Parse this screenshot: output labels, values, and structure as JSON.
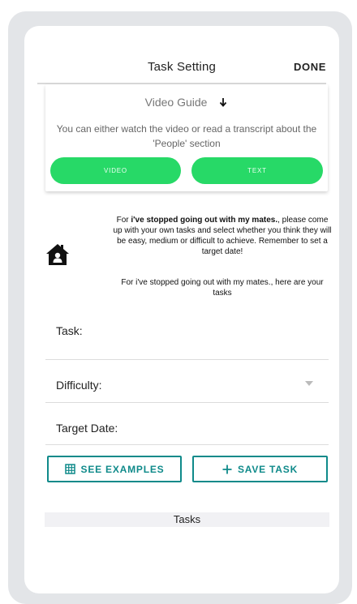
{
  "header": {
    "title": "Task Setting",
    "done_label": "DONE"
  },
  "video_guide": {
    "title": "Video Guide",
    "description": "You can either watch the video or read a transcript about the 'People' section",
    "video_label": "VIDEO",
    "text_label": "TEXT"
  },
  "prompt": {
    "part1": "For ",
    "bold": "i've stopped going out with my mates.",
    "part2": ", please come up with your own tasks and select whether you think they will be easy, medium or difficult to achieve. Remember to set a target date!",
    "tasks_line": "For i've stopped going out with my mates., here are your tasks"
  },
  "form": {
    "task_label": "Task:",
    "difficulty_label": "Difficulty:",
    "target_date_label": "Target Date:"
  },
  "buttons": {
    "see_examples": "SEE EXAMPLES",
    "save_task": "SAVE TASK"
  },
  "tasks_header": "Tasks",
  "colors": {
    "green": "#27d967",
    "teal": "#0f8a8a",
    "frame": "#e3e5e8"
  }
}
